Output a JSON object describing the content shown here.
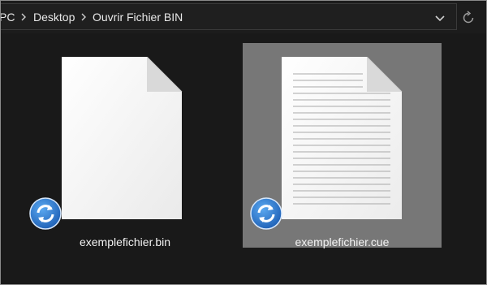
{
  "breadcrumb": {
    "items": [
      {
        "label": "PC"
      },
      {
        "label": "Desktop"
      },
      {
        "label": "Ouvrir Fichier BIN"
      }
    ]
  },
  "toolbar": {
    "dropdown_icon": "chevron-down-icon",
    "refresh_icon": "refresh-icon"
  },
  "files": [
    {
      "name": "exemplefichier.bin",
      "icon": "blank-document-icon",
      "badge": "sync-icon",
      "selected": false
    },
    {
      "name": "exemplefichier.cue",
      "icon": "lined-document-icon",
      "badge": "sync-icon",
      "selected": true
    }
  ],
  "colors": {
    "background": "#191919",
    "selection": "#777777",
    "text": "#f2f2f2",
    "badge": "#2a78d2"
  }
}
